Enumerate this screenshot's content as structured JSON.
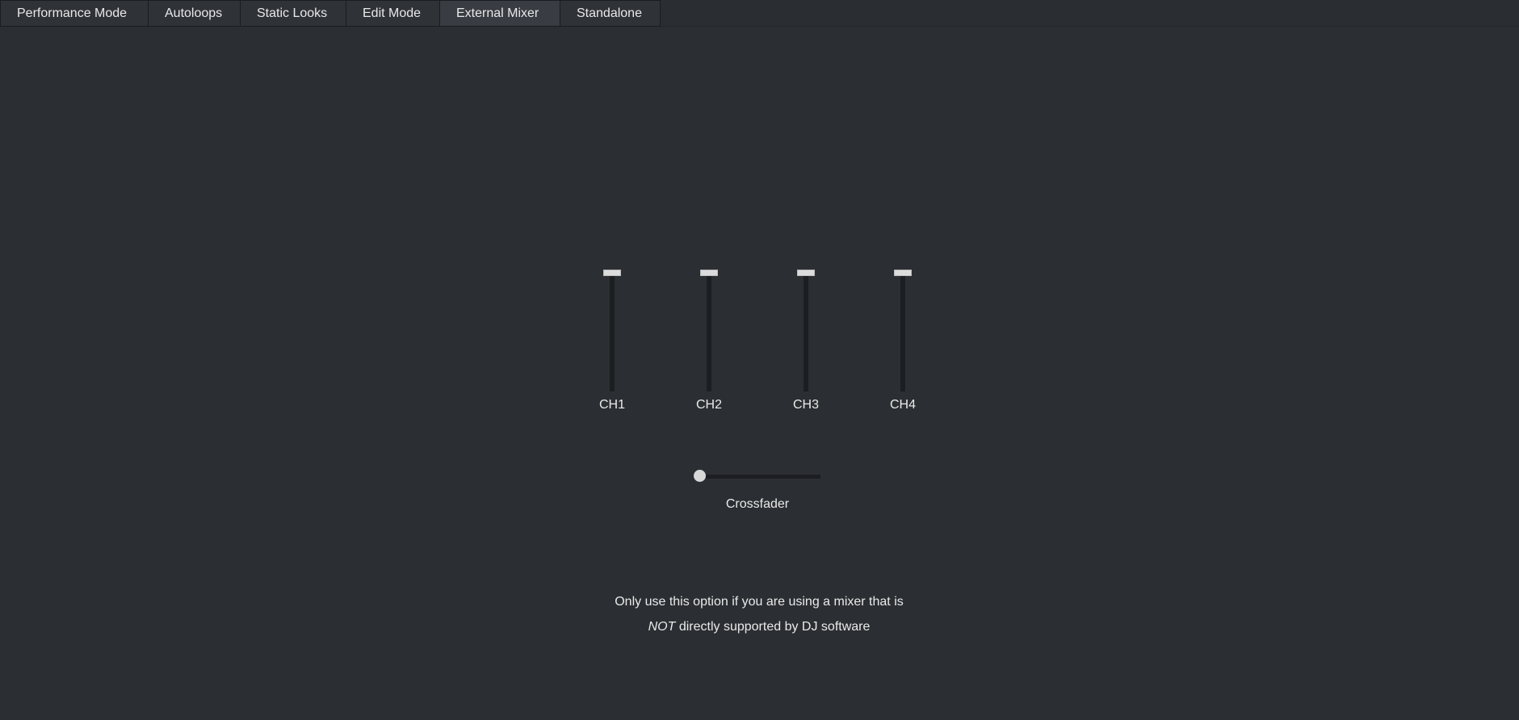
{
  "tabs": [
    {
      "label": "Performance Mode",
      "active": false
    },
    {
      "label": "Autoloops",
      "active": false
    },
    {
      "label": "Static Looks",
      "active": false
    },
    {
      "label": "Edit Mode",
      "active": false
    },
    {
      "label": "External Mixer",
      "active": true
    },
    {
      "label": "Standalone",
      "active": false
    }
  ],
  "channels": [
    {
      "label": "CH1",
      "level": 1.0
    },
    {
      "label": "CH2",
      "level": 1.0
    },
    {
      "label": "CH3",
      "level": 1.0
    },
    {
      "label": "CH4",
      "level": 1.0
    }
  ],
  "crossfader": {
    "label": "Crossfader",
    "position": 0.0
  },
  "note": {
    "line1": "Only use this option if you are using a mixer that is",
    "emphasis": "NOT",
    "line2_rest": " directly supported by DJ software"
  }
}
